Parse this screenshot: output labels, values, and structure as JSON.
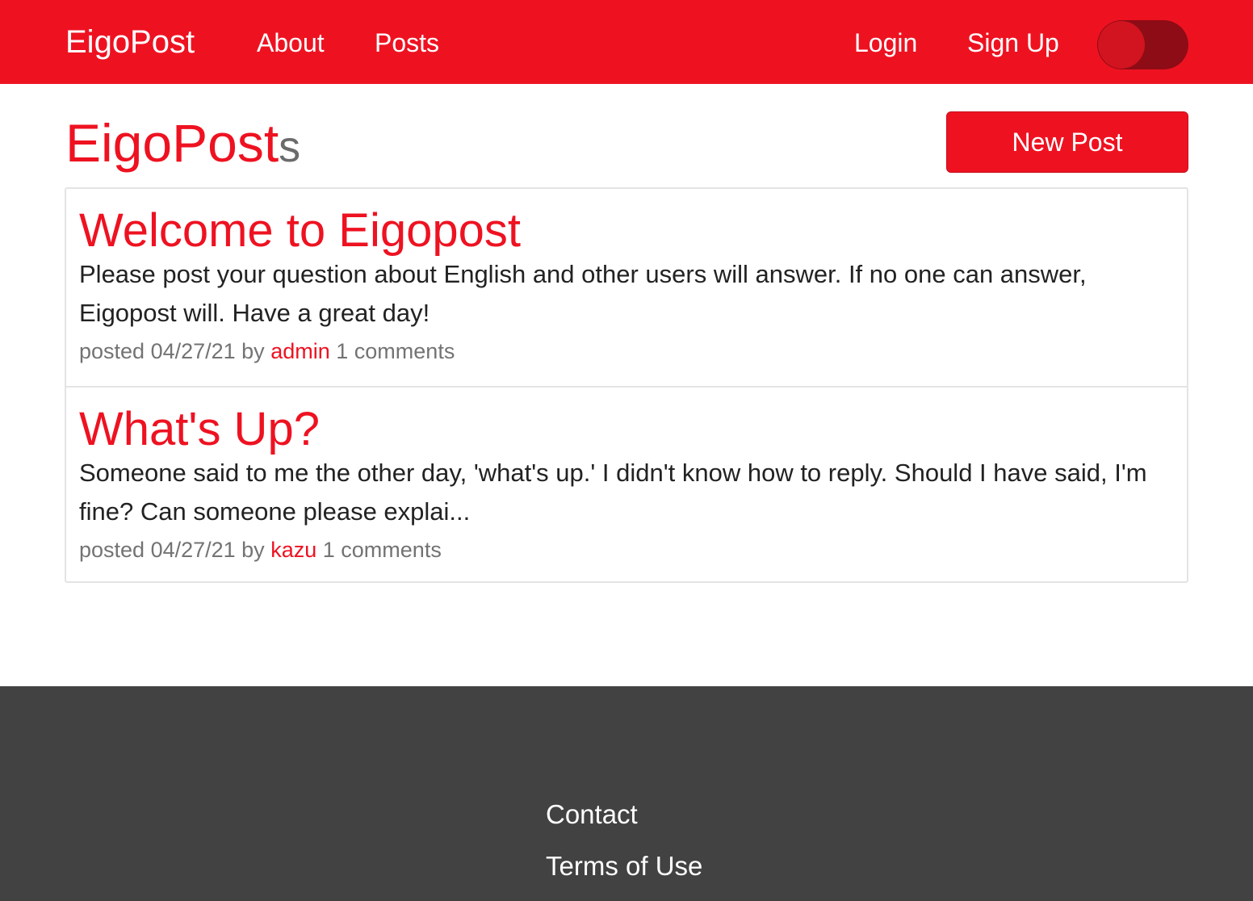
{
  "navbar": {
    "brand": "EigoPost",
    "links": [
      {
        "label": "About"
      },
      {
        "label": "Posts"
      }
    ],
    "auth": {
      "login": "Login",
      "signup": "Sign Up"
    },
    "theme_toggle": {
      "state": "off"
    },
    "colors": {
      "background": "#ee1221",
      "text": "#ffffff"
    }
  },
  "header": {
    "title_main": "EigoPost",
    "title_suffix": "s",
    "new_post_label": "New Post"
  },
  "posts": [
    {
      "title": "Welcome to Eigopost",
      "body": "Please post your question about English and other users will answer. If no one can answer, Eigopost will. Have a great day!",
      "meta_prefix": "posted 04/27/21 by",
      "author": "admin",
      "comments": "1 comments"
    },
    {
      "title": "What's Up?",
      "body": "Someone said to me the other day, 'what's up.' I didn't know how to reply. Should I have said, I'm fine? Can someone please explai...",
      "meta_prefix": "posted 04/27/21 by",
      "author": "kazu",
      "comments": "1 comments"
    }
  ],
  "footer": {
    "links": [
      {
        "label": "Contact"
      },
      {
        "label": "Terms of Use"
      }
    ],
    "colors": {
      "background": "#424242"
    }
  },
  "colors": {
    "accent": "#ee1221",
    "muted": "#737373"
  }
}
